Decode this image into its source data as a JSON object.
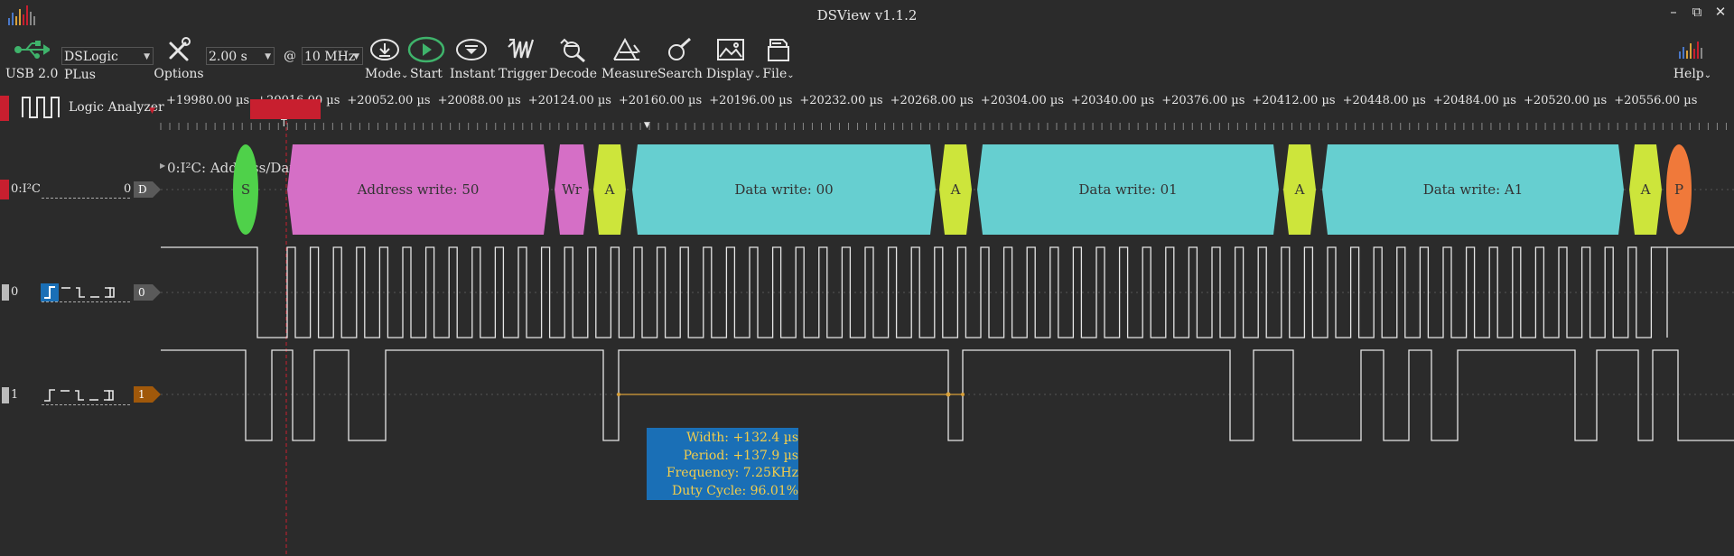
{
  "window": {
    "title": "DSView v1.1.2"
  },
  "toolbar": {
    "device_label": "USB 2.0",
    "device_name": "DSLogic PLus",
    "options": "Options",
    "sample_time": "2.00 s",
    "at": "@",
    "sample_rate": "10 MHz",
    "mode": "Mode",
    "start": "Start",
    "instant": "Instant",
    "trigger": "Trigger",
    "decode": "Decode",
    "measure": "Measure",
    "search": "Search",
    "display": "Display",
    "file": "File",
    "help": "Help"
  },
  "sidebar": {
    "logic_analyzer": "Logic Analyzer"
  },
  "ruler": {
    "ticks": [
      "+19980.00 µs",
      "+20016.00 µs",
      "+20052.00 µs",
      "+20088.00 µs",
      "+20124.00 µs",
      "+20160.00 µs",
      "+20196.00 µs",
      "+20232.00 µs",
      "+20268.00 µs",
      "+20304.00 µs",
      "+20340.00 µs",
      "+20376.00 µs",
      "+20412.00 µs",
      "+20448.00 µs",
      "+20484.00 µs",
      "+20520.00 µs",
      "+20556.00 µs"
    ],
    "trigger_marker": "T"
  },
  "channels": {
    "decoder": {
      "name": "0:I²C",
      "value": "0",
      "tag": "D",
      "title": "0:I²C: Address/Data"
    },
    "ch0": {
      "index": "0",
      "tag": "0"
    },
    "ch1": {
      "index": "1",
      "tag": "1"
    }
  },
  "decode_segments": [
    "S",
    "Address write: 50",
    "Wr",
    "A",
    "Data write: 00",
    "A",
    "Data write: 01",
    "A",
    "Data write: A1",
    "A",
    "P"
  ],
  "measurement": {
    "width": "Width: +132.4 µs",
    "period": "Period: +137.9 µs",
    "frequency": "Frequency: 7.25KHz",
    "duty_cycle": "Duty Cycle: 96.01%"
  },
  "colors": {
    "start": "#4fd14a",
    "address": "#d56fc6",
    "wr": "#d56fc6",
    "ack": "#cde53b",
    "data": "#66cfd0",
    "stop": "#f0793a",
    "measure_line": "#d9a13a",
    "trigger_red": "#c81f2f"
  }
}
